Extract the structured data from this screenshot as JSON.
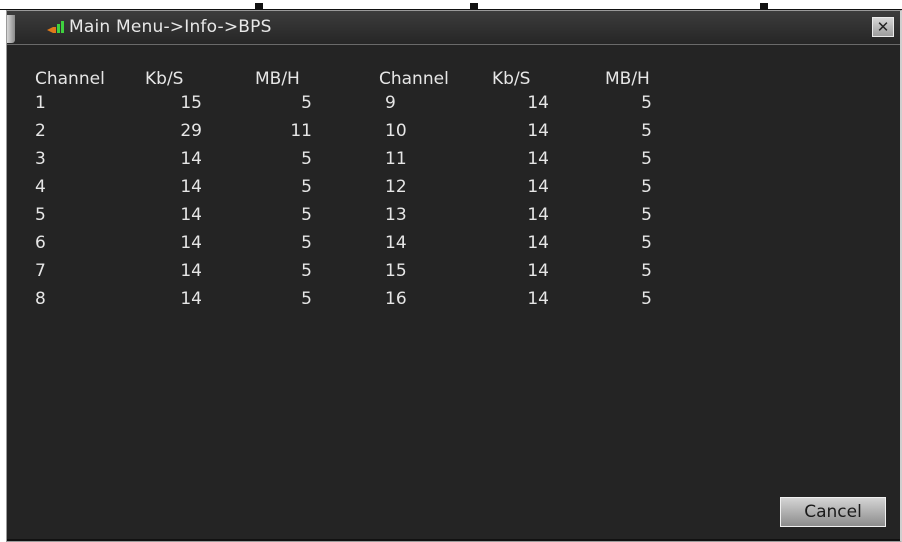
{
  "window": {
    "title": "Main Menu->Info->BPS",
    "close_glyph": "✕"
  },
  "table": {
    "headers_left": [
      "Channel",
      "Kb/S",
      "MB/H"
    ],
    "headers_right": [
      "Channel",
      "Kb/S",
      "MB/H"
    ],
    "rows_left": [
      {
        "channel": "1",
        "kbs": "15",
        "mbh": "5"
      },
      {
        "channel": "2",
        "kbs": "29",
        "mbh": "11"
      },
      {
        "channel": "3",
        "kbs": "14",
        "mbh": "5"
      },
      {
        "channel": "4",
        "kbs": "14",
        "mbh": "5"
      },
      {
        "channel": "5",
        "kbs": "14",
        "mbh": "5"
      },
      {
        "channel": "6",
        "kbs": "14",
        "mbh": "5"
      },
      {
        "channel": "7",
        "kbs": "14",
        "mbh": "5"
      },
      {
        "channel": "8",
        "kbs": "14",
        "mbh": "5"
      }
    ],
    "rows_right": [
      {
        "channel": "9",
        "kbs": "14",
        "mbh": "5"
      },
      {
        "channel": "10",
        "kbs": "14",
        "mbh": "5"
      },
      {
        "channel": "11",
        "kbs": "14",
        "mbh": "5"
      },
      {
        "channel": "12",
        "kbs": "14",
        "mbh": "5"
      },
      {
        "channel": "13",
        "kbs": "14",
        "mbh": "5"
      },
      {
        "channel": "14",
        "kbs": "14",
        "mbh": "5"
      },
      {
        "channel": "15",
        "kbs": "14",
        "mbh": "5"
      },
      {
        "channel": "16",
        "kbs": "14",
        "mbh": "5"
      }
    ]
  },
  "buttons": {
    "cancel_label": "Cancel"
  },
  "icons": {
    "title": "signal-bars-icon",
    "close": "close-icon"
  },
  "colors": {
    "panel_bg": "#242424",
    "text": "#e6e6e6",
    "icon_green": "#3fd13f",
    "icon_orange": "#e07a1a"
  }
}
